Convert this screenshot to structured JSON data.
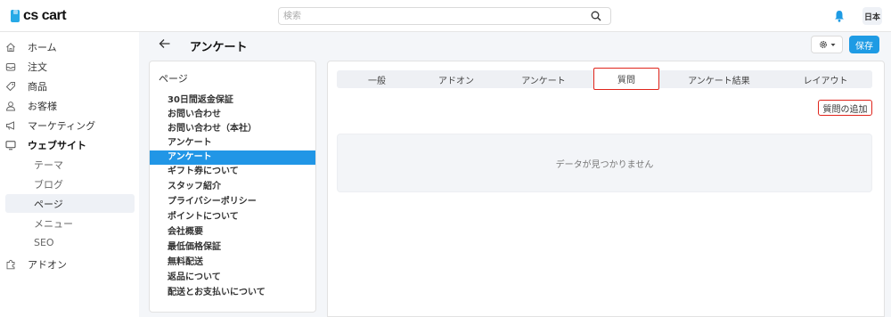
{
  "brand": {
    "name": "cs cart",
    "accent": "#27a9e6"
  },
  "search": {
    "placeholder": "検索",
    "icon": "search-icon"
  },
  "header": {
    "notification_icon": "bell-icon",
    "language": "日本"
  },
  "sidebar": {
    "items": [
      {
        "label": "ホーム",
        "icon": "home-icon"
      },
      {
        "label": "注文",
        "icon": "inbox-icon"
      },
      {
        "label": "商品",
        "icon": "tag-icon"
      },
      {
        "label": "お客様",
        "icon": "user-icon"
      },
      {
        "label": "マーケティング",
        "icon": "megaphone-icon"
      },
      {
        "label": "ウェブサイト",
        "icon": "monitor-icon"
      },
      {
        "label": "アドオン",
        "icon": "puzzle-icon"
      }
    ],
    "website_sub": [
      "テーマ",
      "ブログ",
      "ページ",
      "メニュー",
      "SEO"
    ]
  },
  "page": {
    "title": "アンケート",
    "save_label": "保存",
    "gear_icon": "gear-icon"
  },
  "pages_panel": {
    "title": "ページ",
    "items": [
      "30日間返金保証",
      "お問い合わせ",
      "お問い合わせ（本社）",
      "アンケート",
      "アンケート",
      "ギフト券について",
      "スタッフ紹介",
      "プライバシーポリシー",
      "ポイントについて",
      "会社概要",
      "最低価格保証",
      "無料配送",
      "返品について",
      "配送とお支払いについて"
    ],
    "selected_index": 4
  },
  "tabs": [
    "一般",
    "アドオン",
    "アンケート",
    "質問",
    "アンケート結果",
    "レイアウト"
  ],
  "active_tab": "質問",
  "add_question_label": "質問の追加",
  "empty_message": "データが見つかりません"
}
